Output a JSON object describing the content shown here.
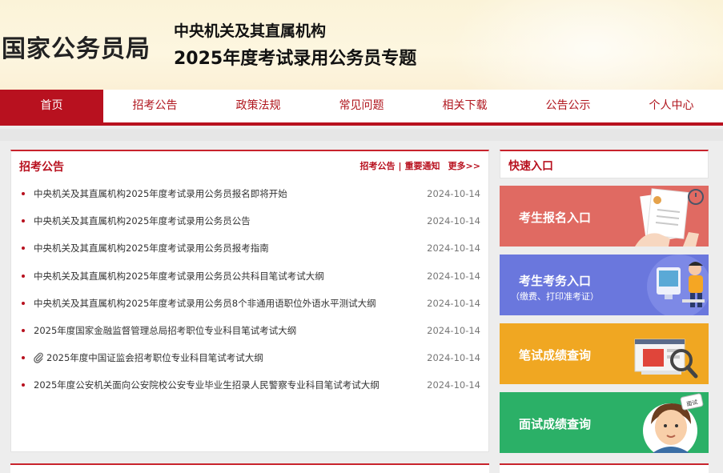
{
  "header": {
    "site_title": "国家公务员局",
    "subtitle_line1": "中央机关及其直属机构",
    "subtitle_line2": "2025年度考试录用公务员专题"
  },
  "nav": {
    "items": [
      {
        "label": "首页",
        "active": true
      },
      {
        "label": "招考公告",
        "active": false
      },
      {
        "label": "政策法规",
        "active": false
      },
      {
        "label": "常见问题",
        "active": false
      },
      {
        "label": "相关下载",
        "active": false
      },
      {
        "label": "公告公示",
        "active": false
      },
      {
        "label": "个人中心",
        "active": false
      }
    ]
  },
  "announcements": {
    "title": "招考公告",
    "links": {
      "link1": "招考公告",
      "separator": "|",
      "link2": "重要通知",
      "more": "更多>>"
    },
    "items": [
      {
        "title": "中央机关及其直属机构2025年度考试录用公务员报名即将开始",
        "date": "2024-10-14",
        "icon": ""
      },
      {
        "title": "中央机关及其直属机构2025年度考试录用公务员公告",
        "date": "2024-10-14",
        "icon": ""
      },
      {
        "title": "中央机关及其直属机构2025年度考试录用公务员报考指南",
        "date": "2024-10-14",
        "icon": ""
      },
      {
        "title": "中央机关及其直属机构2025年度考试录用公务员公共科目笔试考试大纲",
        "date": "2024-10-14",
        "icon": ""
      },
      {
        "title": "中央机关及其直属机构2025年度考试录用公务员8个非通用语职位外语水平测试大纲",
        "date": "2024-10-14",
        "icon": ""
      },
      {
        "title": "2025年度国家金融监督管理总局招考职位专业科目笔试考试大纲",
        "date": "2024-10-14",
        "icon": ""
      },
      {
        "title": "2025年度中国证监会招考职位专业科目笔试考试大纲",
        "date": "2024-10-14",
        "icon": "paperclip-icon"
      },
      {
        "title": "2025年度公安机关面向公安院校公安专业毕业生招录人民警察专业科目笔试考试大纲",
        "date": "2024-10-14",
        "icon": ""
      }
    ]
  },
  "quick_entry": {
    "title": "快速入口",
    "buttons": [
      {
        "label": "考生报名入口",
        "sub": "",
        "color": "#e06a62"
      },
      {
        "label": "考生考务入口",
        "sub": "（缴费、打印准考证）",
        "color": "#6a77dd"
      },
      {
        "label": "笔试成绩查询",
        "sub": "",
        "color": "#f0a722"
      },
      {
        "label": "面试成绩查询",
        "sub": "",
        "color": "#2bb067"
      }
    ]
  },
  "colors": {
    "brand_red": "#b8111f",
    "header_bg": "#fbf3d8"
  }
}
